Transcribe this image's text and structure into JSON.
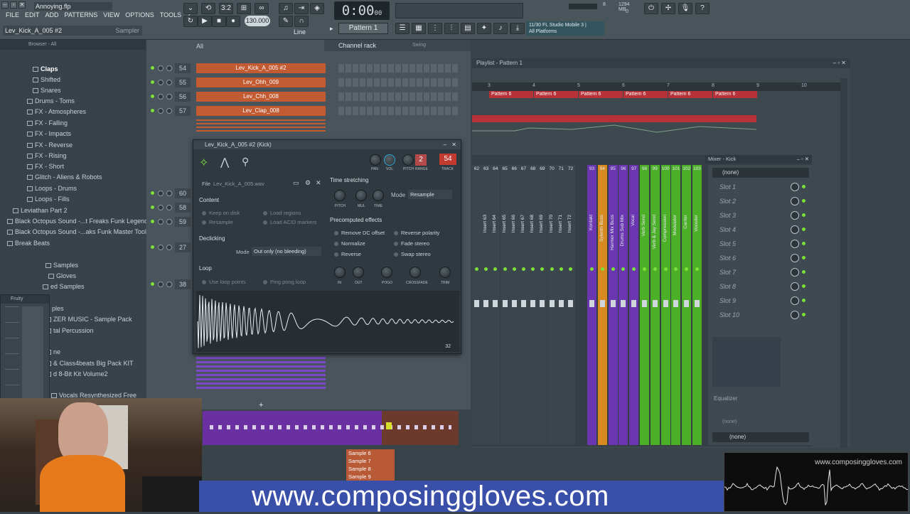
{
  "window": {
    "filename": "Annoying.flp",
    "hint_left": "Lev_Kick_A_005 #2",
    "hint_right": "Sampler"
  },
  "menu": [
    "FILE",
    "EDIT",
    "ADD",
    "PATTERNS",
    "VIEW",
    "OPTIONS",
    "TOOLS",
    "?"
  ],
  "transport": {
    "time": "0:00",
    "time_small": "00",
    "tempo": "130.000",
    "pattern": "Pattern 1",
    "snap": "Line",
    "pat_song": "3:2"
  },
  "cpu": {
    "a": "8",
    "b": "1294 MB",
    "c": "0"
  },
  "news": {
    "line1": "11/30 FL Studio Mobile 3 |",
    "line2": "All Platforms"
  },
  "browser": {
    "title": "Browser - All",
    "items": [
      {
        "label": "Claps",
        "indent": 58,
        "selected": true
      },
      {
        "label": "Shifted",
        "indent": 58
      },
      {
        "label": "Snares",
        "indent": 58
      },
      {
        "label": "Drums - Toms",
        "indent": 50
      },
      {
        "label": "FX - Atmospheres",
        "indent": 50
      },
      {
        "label": "FX - Falling",
        "indent": 50
      },
      {
        "label": "FX - Impacts",
        "indent": 50
      },
      {
        "label": "FX - Reverse",
        "indent": 50
      },
      {
        "label": "FX - Rising",
        "indent": 50
      },
      {
        "label": "FX - Short",
        "indent": 50
      },
      {
        "label": "Glitch - Aliens & Robots",
        "indent": 50
      },
      {
        "label": "Loops - Drums",
        "indent": 50
      },
      {
        "label": "Loops - Fills",
        "indent": 50
      },
      {
        "label": "Leviathan Part 2",
        "indent": 30
      },
      {
        "label": "Black Octopus Sound -...t Freaks Funk Legends",
        "indent": 22
      },
      {
        "label": "Black Octopus Sound -...aks Funk Master Tools",
        "indent": 22
      },
      {
        "label": "Break Beats",
        "indent": 22
      },
      {
        "label": "Samples",
        "indent": 76
      },
      {
        "label": "Gloves",
        "indent": 80
      },
      {
        "label": "ed Samples",
        "indent": 72
      },
      {
        "label": "ples",
        "indent": 74
      },
      {
        "label": "ZER MUSIC - Sample Pack",
        "indent": 76
      },
      {
        "label": "tal Percussion",
        "indent": 76
      },
      {
        "label": "ne",
        "indent": 76
      },
      {
        "label": "& Class4beats Big Pack KIT",
        "indent": 76
      },
      {
        "label": "d 8-Bit Kit Volume2",
        "indent": 76
      },
      {
        "label": "Vocals Resynthesized Free",
        "indent": 84
      }
    ],
    "fruity": "Fruity"
  },
  "channel_rack": {
    "title": "Channel rack",
    "filter": "All",
    "swing": "Swing",
    "rows": [
      {
        "num": "54",
        "name": "Lev_Kick_A_005 #2"
      },
      {
        "num": "55",
        "name": "Lev_Ohh_009"
      },
      {
        "num": "56",
        "name": "Lev_Chh_008"
      },
      {
        "num": "57",
        "name": "Lev_Clap_008"
      }
    ],
    "hidden_rows": [
      "60",
      "58",
      "59",
      "27",
      "38"
    ]
  },
  "sampler": {
    "title": "Lev_Kick_A_005 #2 (Kick)",
    "file_label": "File",
    "file_name": "Lev_Kick_A_005.wav",
    "knob_labels": [
      "PAN",
      "VOL",
      "PITCH",
      "RANGE",
      "TRACK"
    ],
    "range_value": "2",
    "track_value": "54",
    "content": "Content",
    "content_opts": [
      "Keep on disk",
      "Resample",
      "Load regions",
      "Load ACID markers"
    ],
    "declicking": "Declicking",
    "mode_label": "Mode",
    "declick_mode": "Out only (no bleeding)",
    "loop": "Loop",
    "loop_opts": [
      "Use loop points",
      "Ping pong loop"
    ],
    "time_stretching": "Time stretching",
    "ts_knobs": [
      "PITCH",
      "MUL",
      "TIME"
    ],
    "ts_mode": "Resample",
    "precomputed": "Precomputed effects",
    "effects": [
      "Remove DC offset",
      "Normalize",
      "Reverse",
      "Reverse polarity",
      "Fade stereo",
      "Swap stereo"
    ],
    "fx_knobs": [
      "IN",
      "OUT",
      "POGO",
      "CROSSFADE",
      "TRIM"
    ],
    "wave_footer": "32"
  },
  "playlist": {
    "title": "Playlist - Pattern 1",
    "ruler": [
      "3",
      "4",
      "5",
      "6",
      "7",
      "8",
      "9",
      "10"
    ],
    "blocks": [
      "Pattern 6",
      "Pattern 6",
      "Pattern 6",
      "Pattern 6",
      "Pattern 6",
      "Pattern 6"
    ]
  },
  "mixer": {
    "title": "Mixer - Kick",
    "inserts": [
      "62",
      "63",
      "64",
      "65",
      "66",
      "67",
      "68",
      "69",
      "70",
      "71",
      "72",
      "93",
      "94",
      "95",
      "96",
      "97",
      "98",
      "99",
      "100",
      "101",
      "102",
      "103"
    ],
    "channel_names": [
      "Insert 63",
      "Insert 64",
      "Insert 65",
      "Insert 66",
      "Insert 67",
      "Insert 68",
      "Insert 69",
      "Insert 70",
      "Insert 71",
      "Insert 72",
      "Kontakt",
      "Sylenth Buss",
      "Harmor Mix Buss",
      "Drums Sub Mix",
      "Vocal",
      "Verb Send",
      "Verb & Jay Send",
      "Compression",
      "Modulator",
      "Carrier",
      "Vocoder"
    ],
    "insert_select": "(none)",
    "slots": [
      "Slot 1",
      "Slot 2",
      "Slot 3",
      "Slot 4",
      "Slot 5",
      "Slot 6",
      "Slot 7",
      "Slot 8",
      "Slot 9",
      "Slot 10"
    ],
    "eq_label": "Equalizer",
    "bottom1": "(none)",
    "bottom2": "(none)"
  },
  "piano": {
    "samples": [
      "Sample 6",
      "Sample 7",
      "Sample 8",
      "Sample 9",
      "Sample 10",
      "Sample 11"
    ]
  },
  "overlay": {
    "url": "www.composinggloves.com",
    "scope_url": "www.composinggloves.com"
  },
  "colors": {
    "accent_orange": "#c25a32",
    "mixer_purple": "#6a37b0",
    "mixer_orange": "#d68a1f",
    "mixer_green": "#4caf28",
    "pattern_red": "#b73139",
    "led_green": "#7de03a"
  }
}
